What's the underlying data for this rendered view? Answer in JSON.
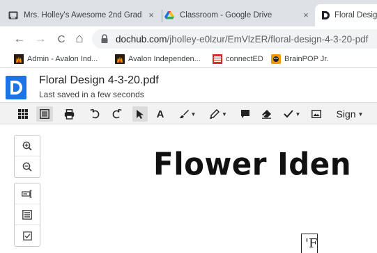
{
  "browser": {
    "tabs": [
      {
        "title": "Mrs. Holley's Awesome 2nd Grad",
        "favicon": "classroom-board-icon",
        "close": "×"
      },
      {
        "title": "Classroom - Google Drive",
        "favicon": "google-drive-icon",
        "close": "×"
      },
      {
        "title": "Floral Desig",
        "favicon": "dochub-icon"
      }
    ],
    "url": {
      "domain": "dochub.com",
      "path": "/jholley-e0lzur/EmVlzER/floral-design-4-3-20-pdf"
    },
    "nav_icons": {
      "back": "←",
      "forward": "→",
      "reload": "C",
      "home": "⌂"
    },
    "bookmarks": [
      {
        "label": "Admin - Avalon Ind...",
        "icon": "avalon-flame-icon"
      },
      {
        "label": "Avalon Independen...",
        "icon": "avalon-flame-icon"
      },
      {
        "label": "connectED",
        "icon": "connected-icon"
      },
      {
        "label": "BrainPOP Jr.",
        "icon": "brainpop-icon"
      }
    ]
  },
  "document": {
    "name": "Floral Design 4-3-20.pdf",
    "status": "Last saved in a few seconds"
  },
  "toolbar": {
    "text_tool": "A",
    "sign_label": "Sign"
  },
  "page": {
    "heading": "Flower Iden",
    "box_letter": "'F"
  },
  "colors": {
    "accent": "#1a73e8",
    "tabstrip": "#dee1e6",
    "toolbar_bg": "#f2f2f2"
  }
}
